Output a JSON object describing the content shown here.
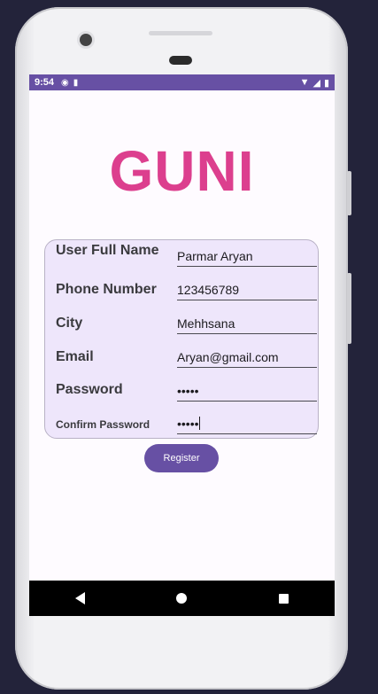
{
  "statusbar": {
    "time": "9:54",
    "icons": [
      "app-notification-icon",
      "sd-card-icon",
      "wifi-icon",
      "signal-icon",
      "battery-icon"
    ]
  },
  "logo": {
    "text": "GUNI",
    "color": "#dc3f8e"
  },
  "form": {
    "full_name_label": "User Full Name",
    "full_name_value": "Parmar Aryan",
    "phone_label": "Phone Number",
    "phone_value": "123456789",
    "city_label": "City",
    "city_value": "Mehhsana",
    "email_label": "Email",
    "email_value": "Aryan@gmail.com",
    "password_label": "Password",
    "password_value": "•••••",
    "confirm_label": "Confirm Password",
    "confirm_value": "•••••"
  },
  "register_label": "Register",
  "colors": {
    "accent": "#6750a4",
    "card": "#eee6fb",
    "background": "#fefbff",
    "logo": "#dc3f8e"
  },
  "navbar": {
    "icons": [
      "back-icon",
      "home-icon",
      "recents-icon"
    ]
  }
}
